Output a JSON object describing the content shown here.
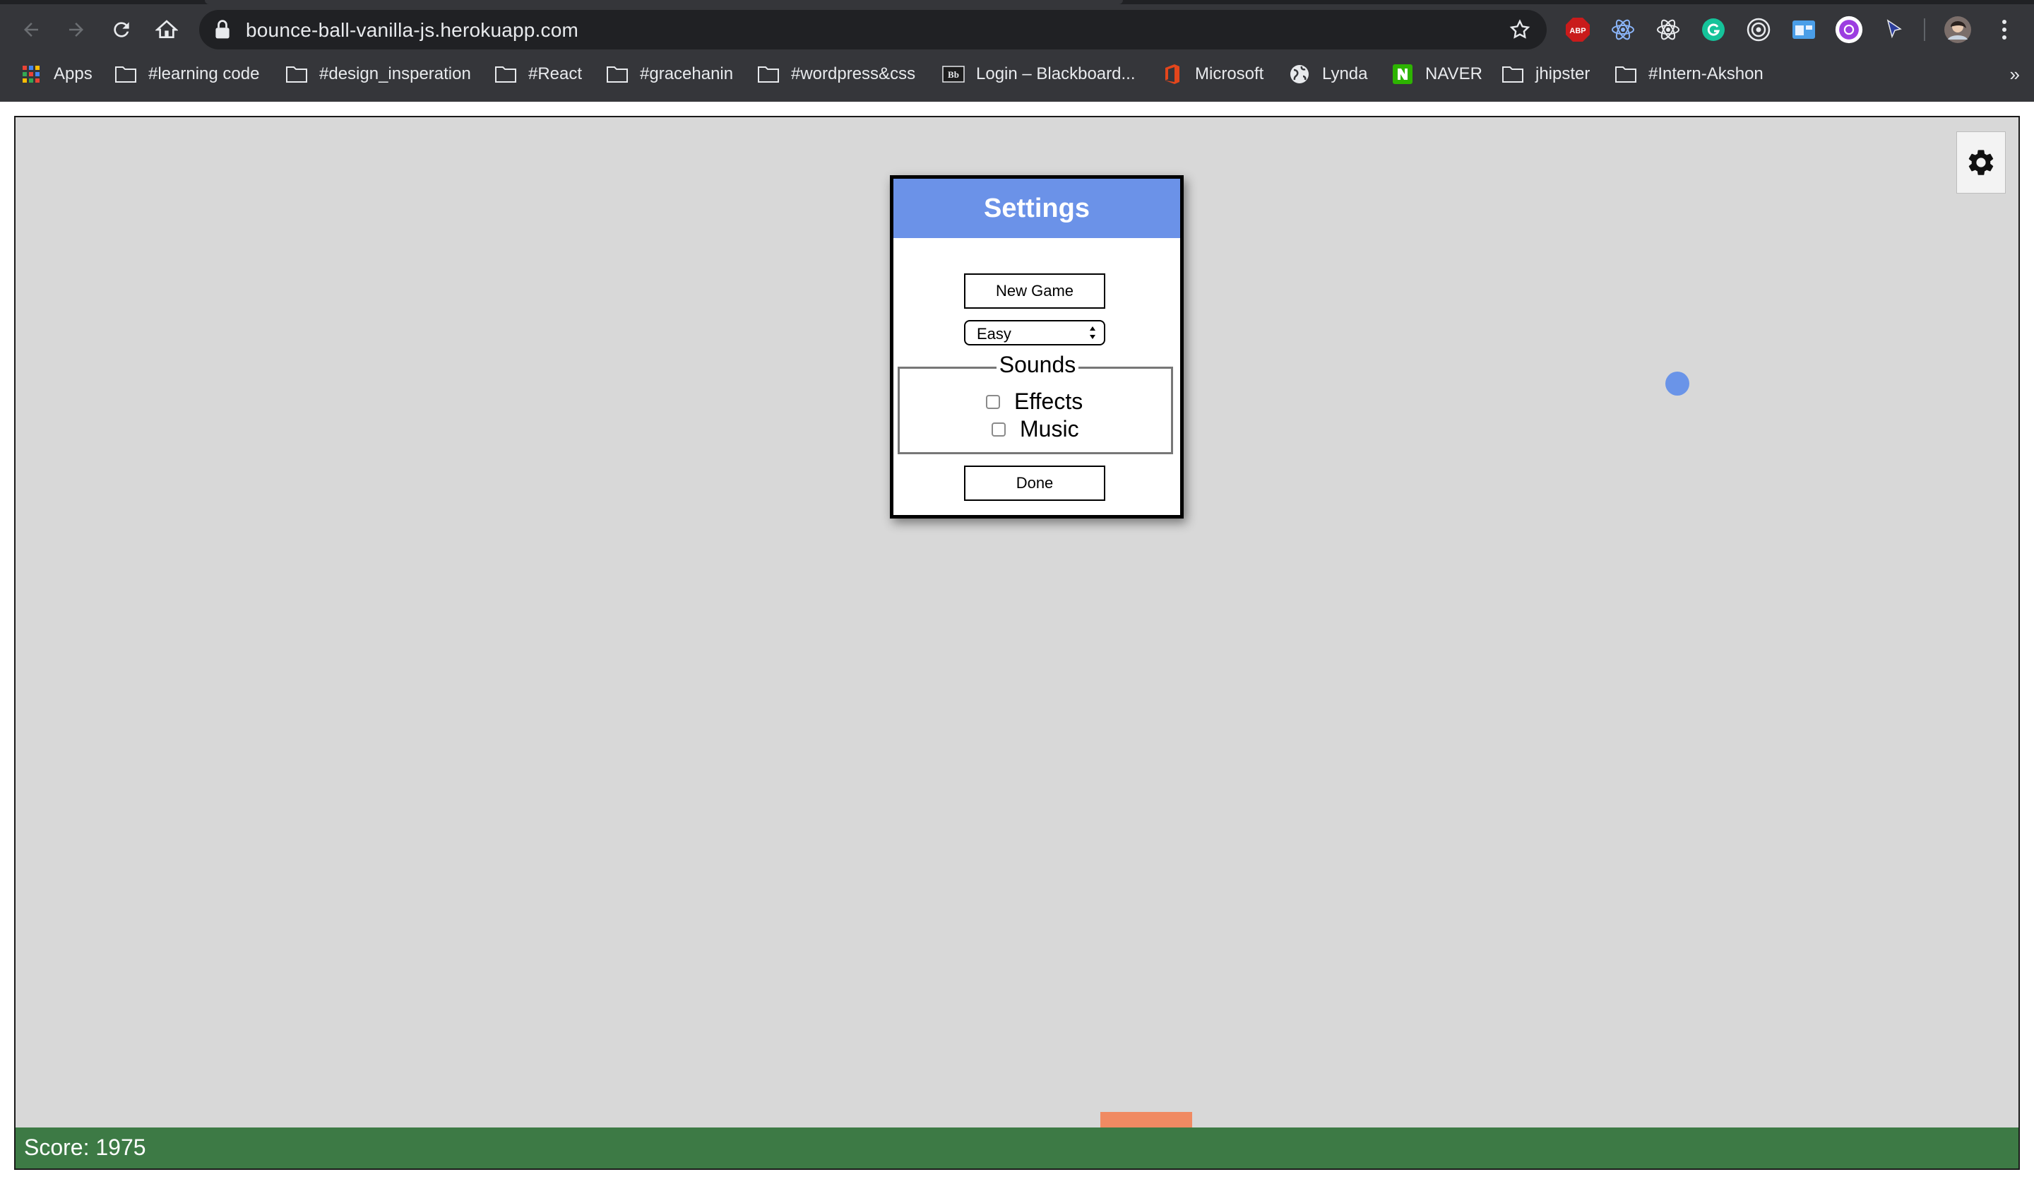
{
  "browser": {
    "url": "bounce-ball-vanilla-js.herokuapp.com",
    "bookmarks": [
      {
        "label": "Apps",
        "icon": "apps-grid-icon"
      },
      {
        "label": "#learning code",
        "icon": "folder-icon"
      },
      {
        "label": "#design_insperation",
        "icon": "folder-icon"
      },
      {
        "label": "#React",
        "icon": "folder-icon"
      },
      {
        "label": "#gracehanin",
        "icon": "folder-icon"
      },
      {
        "label": "#wordpress&css",
        "icon": "folder-icon"
      },
      {
        "label": "Login – Blackboard...",
        "icon": "blackboard-icon"
      },
      {
        "label": "Microsoft",
        "icon": "office-icon"
      },
      {
        "label": "Lynda",
        "icon": "globe-icon"
      },
      {
        "label": "NAVER",
        "icon": "naver-icon"
      },
      {
        "label": "jhipster",
        "icon": "folder-icon"
      },
      {
        "label": "#Intern-Akshon",
        "icon": "folder-icon"
      }
    ],
    "extensions": [
      "abp-icon",
      "react-devtools-icon",
      "react-icon",
      "grammarly-icon",
      "target-icon",
      "window-icon",
      "purple-circle-icon",
      "cursor-icon",
      "profile-avatar"
    ],
    "abp_label": "ABP"
  },
  "game": {
    "score_text": "Score: 1975",
    "colors": {
      "background": "#d8d8d8",
      "ball": "#6a94e8",
      "paddle": "#f08a62",
      "scorebar": "#3d7a45",
      "modal_header": "#6b92e8"
    }
  },
  "settings": {
    "title": "Settings",
    "new_game_label": "New Game",
    "difficulty_selected": "Easy",
    "sounds_legend": "Sounds",
    "effects_label": "Effects",
    "music_label": "Music",
    "effects_checked": false,
    "music_checked": false,
    "done_label": "Done"
  }
}
